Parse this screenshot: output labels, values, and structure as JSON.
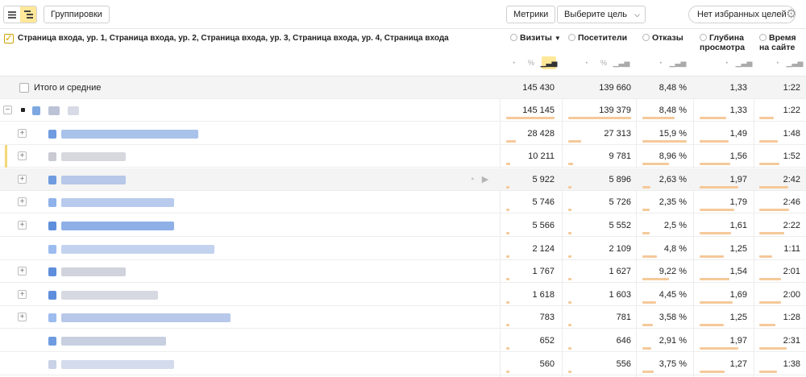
{
  "toolbar": {
    "groupings_label": "Группировки",
    "metrics_label": "Метрики",
    "goal_label": "Выберите цель",
    "favorites_label": "Нет избранных целей"
  },
  "header": {
    "dimensions_title": "Страница входа, ур. 1, Страница входа, ур. 2, Страница входа, ур. 3, Страница входа, ур. 4, Страница входа",
    "columns": [
      "Визиты",
      "Посетители",
      "Отказы",
      "Глубина просмотра",
      "Время на сайте"
    ],
    "sort_indicator": "▼"
  },
  "totals": {
    "label": "Итого и средние",
    "values": [
      "145 430",
      "139 660",
      "8,48 %",
      "1,33",
      "1:22"
    ]
  },
  "rows": [
    {
      "values": [
        "145 145",
        "139 379",
        "8,48 %",
        "1,33",
        "1:22"
      ],
      "bars": [
        1.0,
        1.0,
        0.72,
        0.55,
        0.35
      ]
    },
    {
      "values": [
        "28 428",
        "27 313",
        "15,9 %",
        "1,49",
        "1:48"
      ],
      "bars": [
        0.2,
        0.2,
        1.0,
        0.6,
        0.45
      ]
    },
    {
      "values": [
        "10 211",
        "9 781",
        "8,96 %",
        "1,56",
        "1:52"
      ],
      "bars": [
        0.08,
        0.08,
        0.6,
        0.63,
        0.48
      ]
    },
    {
      "values": [
        "5 922",
        "5 896",
        "2,63 %",
        "1,97",
        "2:42"
      ],
      "bars": [
        0.05,
        0.05,
        0.18,
        0.8,
        0.7
      ]
    },
    {
      "values": [
        "5 746",
        "5 726",
        "2,35 %",
        "1,79",
        "2:46"
      ],
      "bars": [
        0.05,
        0.05,
        0.16,
        0.72,
        0.72
      ]
    },
    {
      "values": [
        "5 566",
        "5 552",
        "2,5 %",
        "1,61",
        "2:22"
      ],
      "bars": [
        0.05,
        0.05,
        0.17,
        0.65,
        0.6
      ]
    },
    {
      "values": [
        "2 124",
        "2 109",
        "4,8 %",
        "1,25",
        "1:11"
      ],
      "bars": [
        0.03,
        0.03,
        0.32,
        0.5,
        0.3
      ]
    },
    {
      "values": [
        "1 767",
        "1 627",
        "9,22 %",
        "1,54",
        "2:01"
      ],
      "bars": [
        0.03,
        0.03,
        0.6,
        0.62,
        0.52
      ]
    },
    {
      "values": [
        "1 618",
        "1 603",
        "4,45 %",
        "1,69",
        "2:00"
      ],
      "bars": [
        0.03,
        0.03,
        0.3,
        0.68,
        0.52
      ]
    },
    {
      "values": [
        "783",
        "781",
        "3,58 %",
        "1,25",
        "1:28"
      ],
      "bars": [
        0.02,
        0.02,
        0.24,
        0.5,
        0.38
      ]
    },
    {
      "values": [
        "652",
        "646",
        "2,91 %",
        "1,97",
        "2:31"
      ],
      "bars": [
        0.02,
        0.02,
        0.2,
        0.8,
        0.65
      ]
    },
    {
      "values": [
        "560",
        "556",
        "3,75 %",
        "1,27",
        "1:38"
      ],
      "bars": [
        0.02,
        0.02,
        0.25,
        0.51,
        0.42
      ]
    }
  ],
  "icons": {
    "list": "list-view-icon",
    "tree": "tree-view-icon",
    "gear": "gear-icon"
  }
}
